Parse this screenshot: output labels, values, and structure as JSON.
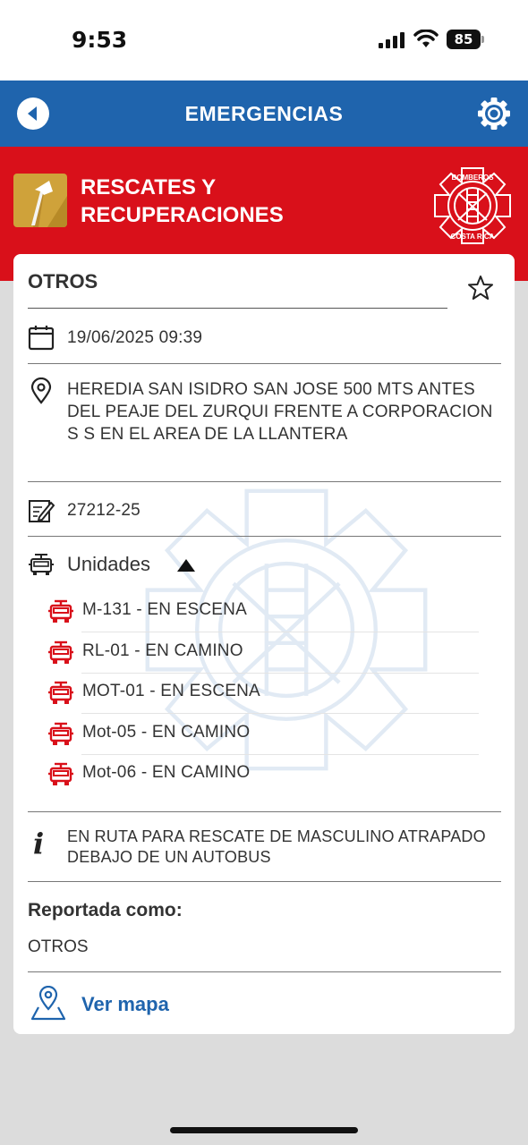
{
  "status_bar": {
    "time": "9:53",
    "battery": "85"
  },
  "nav": {
    "title": "EMERGENCIAS"
  },
  "banner": {
    "category": "RESCATES Y RECUPERACIONES",
    "logo_text_top": "BOMBEROS",
    "logo_text_bottom": "COSTA RICA"
  },
  "incident": {
    "type": "OTROS",
    "datetime": "19/06/2025 09:39",
    "address": "HEREDIA SAN ISIDRO SAN JOSE 500 MTS ANTES DEL PEAJE DEL ZURQUI FRENTE A CORPORACION S S EN EL AREA DE LA LLANTERA",
    "incident_number": "27212-25",
    "units_label": "Unidades",
    "units": [
      "M-131 - EN ESCENA",
      "RL-01 - EN CAMINO",
      "MOT-01 - EN ESCENA",
      "Mot-05 - EN CAMINO",
      "Mot-06 - EN CAMINO"
    ],
    "notes": "EN RUTA PARA RESCATE DE MASCULINO ATRAPADO DEBAJO DE UN AUTOBUS",
    "reported_label": "Reportada como:",
    "reported_value": "OTROS",
    "map_link": "Ver mapa"
  },
  "colors": {
    "nav_blue": "#1f64ad",
    "banner_red": "#d9101a",
    "unit_icon_red": "#d9101a",
    "category_gold": "#cfa23a"
  },
  "icons": {
    "back": "back-arrow-icon",
    "settings": "gear-icon",
    "category": "axe-icon",
    "logo": "bomberos-logo",
    "favorite": "star-outline-icon",
    "date": "calendar-icon",
    "address": "location-pin-icon",
    "incident_number": "edit-note-icon",
    "units": "fire-truck-icon",
    "notes": "info-icon",
    "map": "map-pin-icon"
  }
}
